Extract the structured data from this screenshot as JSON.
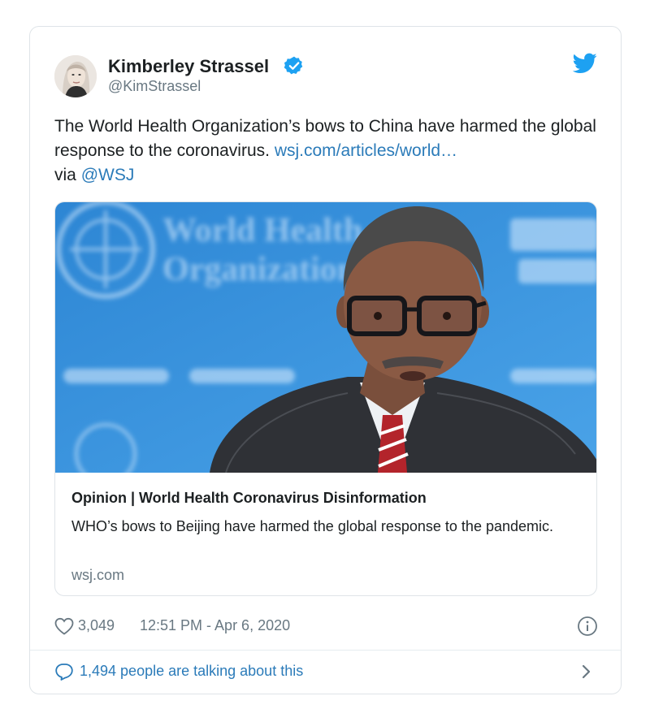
{
  "author": {
    "name": "Kimberley Strassel",
    "handle": "@KimStrassel"
  },
  "tweet": {
    "text": "The World Health Organization’s bows to China have harmed the global response to the coronavirus. ",
    "link": "wsj.com/articles/world…",
    "via_prefix": "via ",
    "mention": "@WSJ"
  },
  "card": {
    "image_text_line1": "World Health",
    "image_text_line2": "Organization",
    "title": "Opinion | World Health Coronavirus Disinformation",
    "description": "WHO’s bows to Beijing have harmed the global response to the pandemic.",
    "domain": "wsj.com"
  },
  "footer": {
    "likes": "3,049",
    "timestamp": "12:51 PM - Apr 6, 2020",
    "conversation": "1,494 people are talking about this"
  },
  "colors": {
    "link": "#2b7bb9",
    "verified": "#1da1f2",
    "muted": "#697882"
  },
  "icons": [
    "verified-badge-icon",
    "twitter-bird-icon",
    "heart-icon",
    "info-icon",
    "comment-icon",
    "chevron-right-icon"
  ]
}
